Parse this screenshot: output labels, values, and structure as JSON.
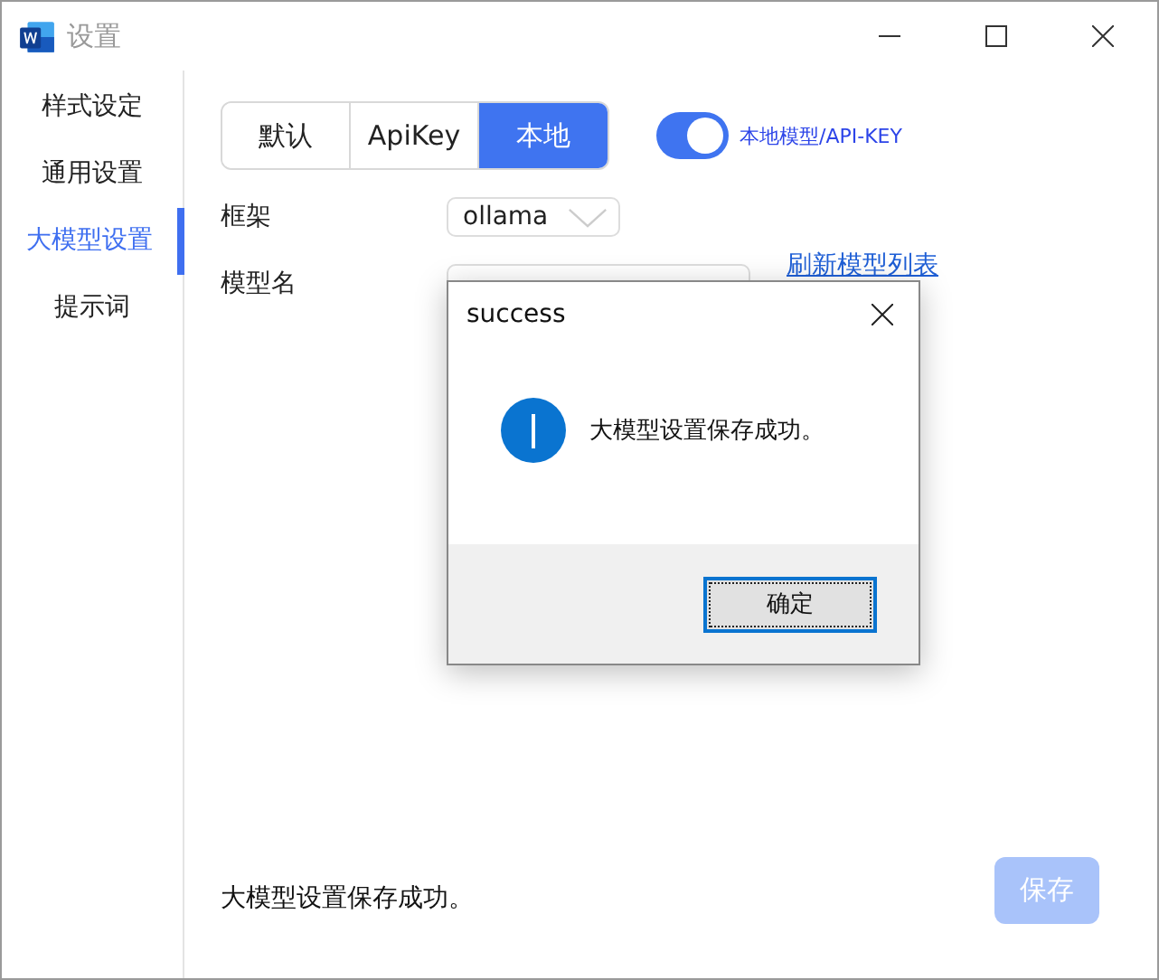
{
  "window": {
    "title": "设置",
    "active": false
  },
  "sidebar": {
    "items": [
      {
        "label": "样式设定",
        "selected": false
      },
      {
        "label": "通用设置",
        "selected": false
      },
      {
        "label": "大模型设置",
        "selected": true
      },
      {
        "label": "提示词",
        "selected": false
      }
    ]
  },
  "mode_tabs": [
    {
      "label": "默认",
      "selected": false
    },
    {
      "label": "ApiKey",
      "selected": false
    },
    {
      "label": "本地",
      "selected": true
    }
  ],
  "toggle": {
    "on": true,
    "label": "本地模型/API-KEY"
  },
  "framework": {
    "label": "框架",
    "value": "ollama"
  },
  "model": {
    "label": "模型名",
    "refresh_link": "刷新模型列表"
  },
  "status_text": "大模型设置保存成功。",
  "save_button": {
    "label": "保存",
    "disabled": true
  },
  "dialog": {
    "title": "success",
    "message": "大模型设置保存成功。",
    "ok_button": "确定"
  }
}
